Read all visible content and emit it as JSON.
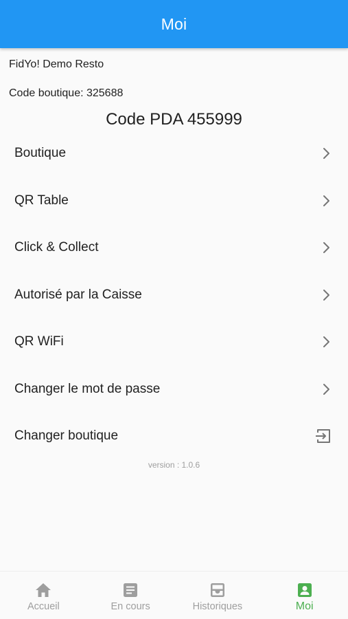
{
  "appbar": {
    "title": "Moi"
  },
  "profile": {
    "shop_name": "FidYo! Demo Resto",
    "shop_code": "Code boutique: 325688",
    "pda_code": "Code PDA 455999"
  },
  "menu": {
    "items": [
      {
        "label": "Boutique",
        "icon": "chevron-right-icon"
      },
      {
        "label": "QR Table",
        "icon": "chevron-right-icon"
      },
      {
        "label": "Click & Collect",
        "icon": "chevron-right-icon"
      },
      {
        "label": "Autorisé par la Caisse",
        "icon": "chevron-right-icon"
      },
      {
        "label": "QR WiFi",
        "icon": "chevron-right-icon"
      },
      {
        "label": "Changer le mot de passe",
        "icon": "chevron-right-icon"
      },
      {
        "label": "Changer boutique",
        "icon": "logout-icon"
      }
    ]
  },
  "version": "version : 1.0.6",
  "bottom_nav": {
    "items": [
      {
        "label": "Accueil",
        "icon": "home-icon",
        "active": false
      },
      {
        "label": "En cours",
        "icon": "document-icon",
        "active": false
      },
      {
        "label": "Historiques",
        "icon": "inbox-icon",
        "active": false
      },
      {
        "label": "Moi",
        "icon": "account-box-icon",
        "active": true
      }
    ]
  },
  "colors": {
    "appbar": "#2196f3",
    "active_tab": "#4caf50",
    "inactive_tab": "#9e9e9e",
    "background": "#fafafa"
  }
}
